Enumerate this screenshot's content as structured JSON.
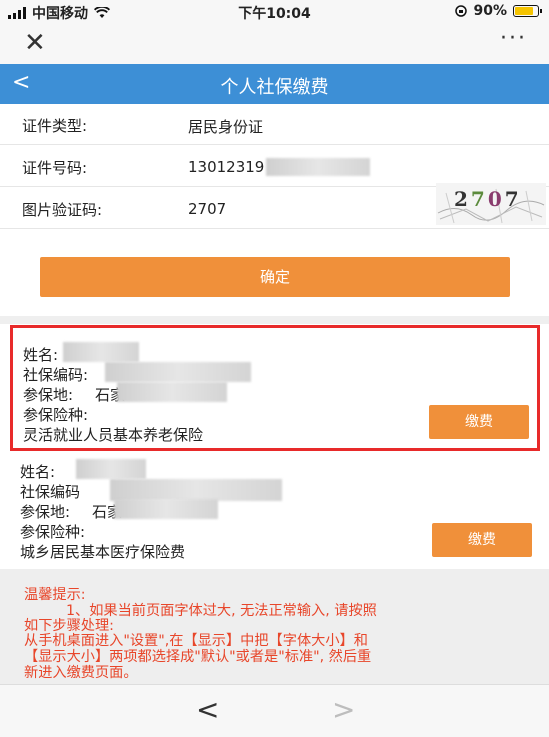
{
  "status": {
    "carrier": "中国移动",
    "time": "下午10:04",
    "battery": "90%",
    "battery_level": 0.9
  },
  "nav": {
    "close_glyph": "✕",
    "more_glyph": "···"
  },
  "header": {
    "back_glyph": "<",
    "title": "个人社保缴费"
  },
  "form": {
    "id_type_label": "证件类型:",
    "id_type_value": "居民身份证",
    "id_number_label": "证件号码:",
    "id_number_value": "13012319",
    "captcha_label": "图片验证码:",
    "captcha_value": "2707",
    "captcha_image_text": [
      "2",
      "7",
      "0",
      "7"
    ],
    "confirm_label": "确定"
  },
  "records": [
    {
      "name_label": "姓名:",
      "code_label": "社保编码:",
      "place_label": "参保地:",
      "place_value": "石家",
      "type_label": "参保险种:",
      "type_value": "灵活就业人员基本养老保险",
      "pay_label": "缴费"
    },
    {
      "name_label": "姓名:",
      "code_label": "社保编码",
      "place_label": "参保地:",
      "place_value": "石家",
      "type_label": "参保险种:",
      "type_value": "城乡居民基本医疗保险费",
      "pay_label": "缴费"
    }
  ],
  "tip": {
    "title": "温馨提示:",
    "line1": "1、如果当前页面字体过大, 无法正常输入, 请按照",
    "line2": "如下步骤处理:",
    "line3": "从手机桌面进入\"设置\",在【显示】中把【字体大小】和",
    "line4": "【显示大小】两项都选择成\"默认\"或者是\"标准\", 然后重",
    "line5": "新进入缴费页面。"
  },
  "bottom": {
    "prev_glyph": "<",
    "next_glyph": ">"
  }
}
